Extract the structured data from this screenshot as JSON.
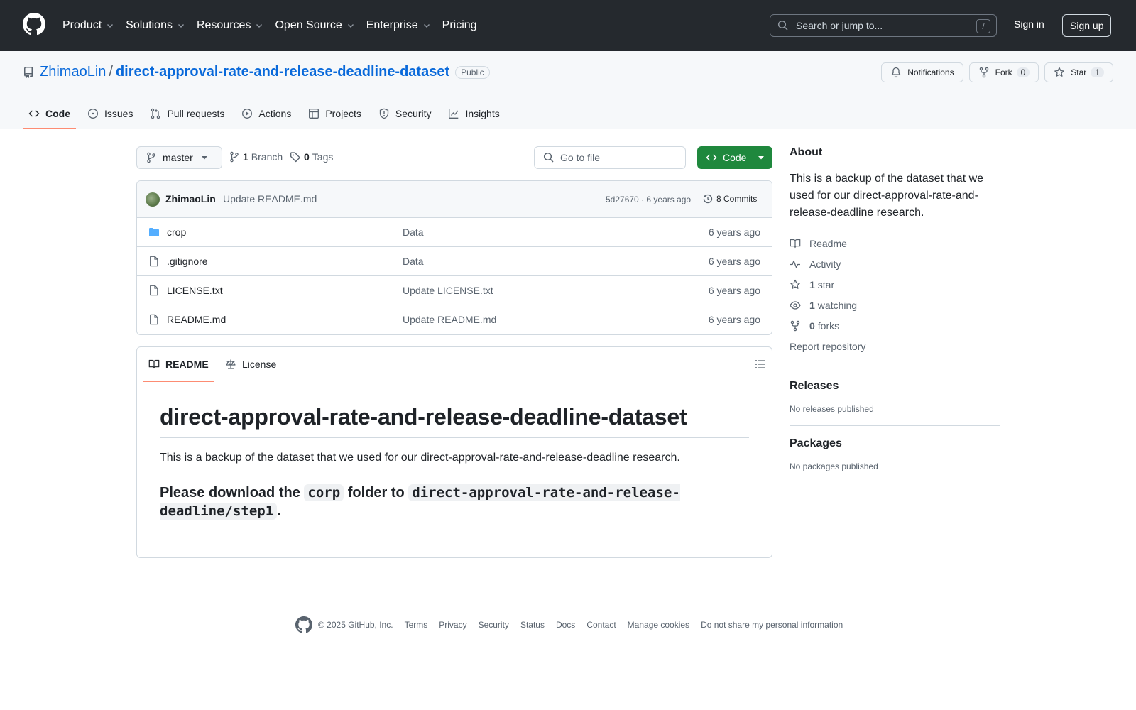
{
  "header": {
    "nav": [
      "Product",
      "Solutions",
      "Resources",
      "Open Source",
      "Enterprise",
      "Pricing"
    ],
    "search_placeholder": "Search or jump to...",
    "search_key": "/",
    "sign_in": "Sign in",
    "sign_up": "Sign up"
  },
  "repo": {
    "owner": "ZhimaoLin",
    "separator": "/",
    "name": "direct-approval-rate-and-release-deadline-dataset",
    "visibility": "Public",
    "notifications_label": "Notifications",
    "fork_label": "Fork",
    "fork_count": "0",
    "star_label": "Star",
    "star_count": "1"
  },
  "tabs": [
    "Code",
    "Issues",
    "Pull requests",
    "Actions",
    "Projects",
    "Security",
    "Insights"
  ],
  "toolbar": {
    "branch": "master",
    "branch_count": "1",
    "branch_label": "Branch",
    "tag_count": "0",
    "tag_label": "Tags",
    "goto_placeholder": "Go to file",
    "code_label": "Code"
  },
  "latest_commit": {
    "author": "ZhimaoLin",
    "message": "Update README.md",
    "hash_age": "5d27670 · 6 years ago",
    "commits": "8 Commits"
  },
  "files": [
    {
      "type": "folder",
      "name": "crop",
      "message": "Data",
      "date": "6 years ago"
    },
    {
      "type": "file",
      "name": ".gitignore",
      "message": "Data",
      "date": "6 years ago"
    },
    {
      "type": "file",
      "name": "LICENSE.txt",
      "message": "Update LICENSE.txt",
      "date": "6 years ago"
    },
    {
      "type": "file",
      "name": "README.md",
      "message": "Update README.md",
      "date": "6 years ago"
    }
  ],
  "readme": {
    "tab_readme": "README",
    "tab_license": "License",
    "title": "direct-approval-rate-and-release-deadline-dataset",
    "paragraph": "This is a backup of the dataset that we used for our direct-approval-rate-and-release-deadline research.",
    "h3_pre": "Please download the ",
    "h3_code1": "corp",
    "h3_mid": " folder to ",
    "h3_code2": "direct-approval-rate-and-release-deadline/step1",
    "h3_post": "."
  },
  "about": {
    "heading": "About",
    "description": "This is a backup of the dataset that we used for our direct-approval-rate-and-release-deadline research.",
    "readme": "Readme",
    "activity": "Activity",
    "stars_count": "1",
    "stars_label": "star",
    "watching_count": "1",
    "watching_label": "watching",
    "forks_count": "0",
    "forks_label": "forks",
    "report": "Report repository"
  },
  "releases": {
    "heading": "Releases",
    "text": "No releases published"
  },
  "packages": {
    "heading": "Packages",
    "text": "No packages published"
  },
  "footer": {
    "copyright": "© 2025 GitHub, Inc.",
    "links": [
      "Terms",
      "Privacy",
      "Security",
      "Status",
      "Docs",
      "Contact",
      "Manage cookies",
      "Do not share my personal information"
    ]
  }
}
